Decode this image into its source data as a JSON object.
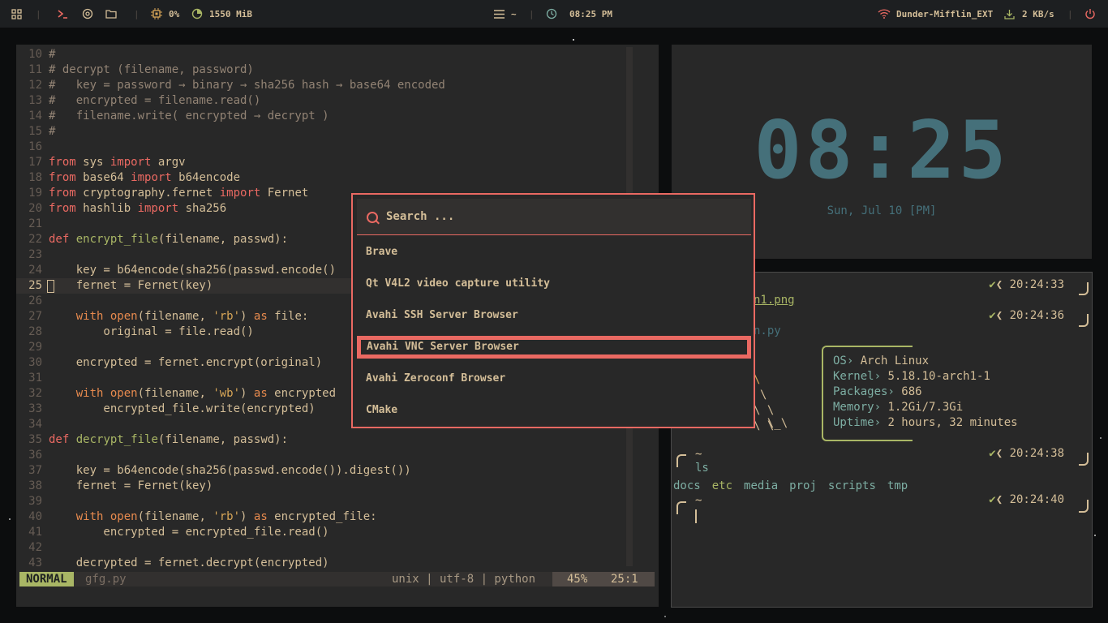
{
  "topbar": {
    "cpu": "0%",
    "memory": "1550 MiB",
    "workspace": "~",
    "time": "08:25 PM",
    "network": "Dunder-Mifflin_EXT",
    "speed": "2 KB/s"
  },
  "editor": {
    "lines": [
      {
        "n": "10",
        "segs": [
          [
            "c",
            "#"
          ]
        ]
      },
      {
        "n": "11",
        "segs": [
          [
            "c",
            "# decrypt (filename, password)"
          ]
        ]
      },
      {
        "n": "12",
        "segs": [
          [
            "c",
            "#   key = password → binary → sha256 hash → base64 encoded"
          ]
        ]
      },
      {
        "n": "13",
        "segs": [
          [
            "c",
            "#   encrypted = filename.read()"
          ]
        ]
      },
      {
        "n": "14",
        "segs": [
          [
            "c",
            "#   filename.write( encrypted → decrypt )"
          ]
        ]
      },
      {
        "n": "15",
        "segs": [
          [
            "c",
            "#"
          ]
        ]
      },
      {
        "n": "16",
        "segs": []
      },
      {
        "n": "17",
        "segs": [
          [
            "k",
            "from"
          ],
          [
            "t",
            " sys "
          ],
          [
            "k",
            "import"
          ],
          [
            "t",
            " argv"
          ]
        ]
      },
      {
        "n": "18",
        "segs": [
          [
            "k",
            "from"
          ],
          [
            "t",
            " base64 "
          ],
          [
            "k",
            "import"
          ],
          [
            "t",
            " b64encode"
          ]
        ]
      },
      {
        "n": "19",
        "segs": [
          [
            "k",
            "from"
          ],
          [
            "t",
            " cryptography.fernet "
          ],
          [
            "k",
            "import"
          ],
          [
            "t",
            " Fernet"
          ]
        ]
      },
      {
        "n": "20",
        "segs": [
          [
            "k",
            "from"
          ],
          [
            "t",
            " hashlib "
          ],
          [
            "k",
            "import"
          ],
          [
            "t",
            " sha256"
          ]
        ]
      },
      {
        "n": "21",
        "segs": []
      },
      {
        "n": "22",
        "segs": [
          [
            "k",
            "def"
          ],
          [
            "t",
            " "
          ],
          [
            "f",
            "encrypt_file"
          ],
          [
            "t",
            "(filename, passwd):"
          ]
        ]
      },
      {
        "n": "23",
        "segs": []
      },
      {
        "n": "24",
        "segs": [
          [
            "t",
            "    key = b64encode(sha256(passwd.encode()"
          ]
        ]
      },
      {
        "n": "25",
        "segs": [
          [
            "t",
            "    fernet = Fernet(key)"
          ]
        ],
        "current": true
      },
      {
        "n": "26",
        "segs": []
      },
      {
        "n": "27",
        "segs": [
          [
            "t",
            "    "
          ],
          [
            "o",
            "with"
          ],
          [
            "t",
            " "
          ],
          [
            "o",
            "open"
          ],
          [
            "t",
            "(filename, "
          ],
          [
            "s",
            "'rb'"
          ],
          [
            "t",
            ") "
          ],
          [
            "o",
            "as"
          ],
          [
            "t",
            " file:"
          ]
        ]
      },
      {
        "n": "28",
        "segs": [
          [
            "t",
            "        original = file.read()"
          ]
        ]
      },
      {
        "n": "29",
        "segs": []
      },
      {
        "n": "30",
        "segs": [
          [
            "t",
            "    encrypted = fernet.encrypt(original)"
          ]
        ]
      },
      {
        "n": "31",
        "segs": []
      },
      {
        "n": "32",
        "segs": [
          [
            "t",
            "    "
          ],
          [
            "o",
            "with"
          ],
          [
            "t",
            " "
          ],
          [
            "o",
            "open"
          ],
          [
            "t",
            "(filename, "
          ],
          [
            "s",
            "'wb'"
          ],
          [
            "t",
            ") "
          ],
          [
            "o",
            "as"
          ],
          [
            "t",
            " encrypted"
          ]
        ]
      },
      {
        "n": "33",
        "segs": [
          [
            "t",
            "        encrypted_file.write(encrypted)"
          ]
        ]
      },
      {
        "n": "34",
        "segs": []
      },
      {
        "n": "35",
        "segs": [
          [
            "k",
            "def"
          ],
          [
            "t",
            " "
          ],
          [
            "f",
            "decrypt_file"
          ],
          [
            "t",
            "(filename, passwd):"
          ]
        ]
      },
      {
        "n": "36",
        "segs": []
      },
      {
        "n": "37",
        "segs": [
          [
            "t",
            "    key = b64encode(sha256(passwd.encode()).digest())"
          ]
        ]
      },
      {
        "n": "38",
        "segs": [
          [
            "t",
            "    fernet = Fernet(key)"
          ]
        ]
      },
      {
        "n": "39",
        "segs": []
      },
      {
        "n": "40",
        "segs": [
          [
            "t",
            "    "
          ],
          [
            "o",
            "with"
          ],
          [
            "t",
            " "
          ],
          [
            "o",
            "open"
          ],
          [
            "t",
            "(filename, "
          ],
          [
            "s",
            "'rb'"
          ],
          [
            "t",
            ") "
          ],
          [
            "o",
            "as"
          ],
          [
            "t",
            " encrypted_file:"
          ]
        ]
      },
      {
        "n": "41",
        "segs": [
          [
            "t",
            "        encrypted = encrypted_file.read()"
          ]
        ]
      },
      {
        "n": "42",
        "segs": []
      },
      {
        "n": "43",
        "segs": [
          [
            "t",
            "    decrypted = fernet.decrypt(encrypted)"
          ]
        ]
      }
    ],
    "status": {
      "mode": "NORMAL",
      "file": "gfg.py",
      "info": "unix | utf-8 | python",
      "percent": "45%",
      "position": "25:1"
    }
  },
  "clock": {
    "digits": "08:25",
    "date": "Sun, Jul 10 [PM]"
  },
  "terminal": {
    "times": [
      "20:24:33",
      "20:24:36",
      "20:24:38",
      "20:24:40"
    ],
    "file1": "n1.png",
    "file2": "n.py",
    "fetch": [
      [
        "OS›",
        " Arch Linux"
      ],
      [
        "Kernel›",
        " 5.18.10-arch1-1"
      ],
      [
        "Packages›",
        " 686"
      ],
      [
        "Memory›",
        " 1.2Gi/7.3Gi"
      ],
      [
        "Uptime›",
        " 2 hours, 32 minutes"
      ]
    ],
    "prompt": "~",
    "command": "ls",
    "ls": [
      "docs",
      "etc",
      "media",
      "proj",
      "scripts",
      "tmp"
    ]
  },
  "launcher": {
    "placeholder": "Search ...",
    "items": [
      "Brave",
      "Qt V4L2 video capture utility",
      "Avahi SSH Server Browser",
      "Avahi VNC Server Browser",
      "Avahi Zeroconf Browser",
      "CMake"
    ],
    "selected": 3
  },
  "colors": {
    "accent": "#ea6962",
    "green": "#a9b665",
    "clock": "#45707a",
    "bg": "#282828"
  }
}
